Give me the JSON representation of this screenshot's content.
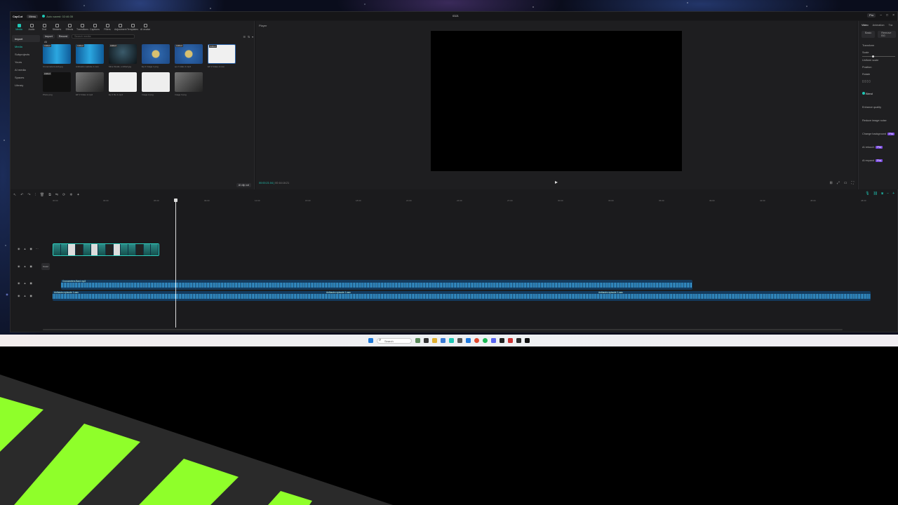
{
  "app": {
    "logo": "CapCut",
    "menu_label": "Menu",
    "autosave": "Auto saved: 02:46:35",
    "project_title": "0321",
    "pro_label": "Pro"
  },
  "toolbar": {
    "tabs": [
      "Media",
      "Audio",
      "Text",
      "Stickers",
      "Effects",
      "Transitions",
      "Captions",
      "Filters",
      "Adjustment",
      "Templates",
      "AI avatar"
    ]
  },
  "sidebar": {
    "items": [
      "Import",
      "Media",
      "Subprojects",
      "Yours",
      "AI media",
      "Spaces",
      "Library"
    ]
  },
  "media": {
    "import_label": "Import",
    "record_label": "Record",
    "search_placeholder": "Search media",
    "filter_all": "All",
    "items": [
      {
        "badge": "Added",
        "caption": "Cronometers.web.jpg"
      },
      {
        "badge": "Added",
        "caption": "Anthastro website 1.mov"
      },
      {
        "badge": "Added",
        "caption": "Mine Studio, untitled.jpg"
      },
      {
        "badge": "",
        "caption": "Ep 2 Image 1.png"
      },
      {
        "badge": "Added",
        "caption": "ep 2 video 1.mp4"
      },
      {
        "badge": "Added",
        "caption": "EP 2 Video 2.mov"
      },
      {
        "badge": "Added",
        "caption": "Photo.png"
      },
      {
        "badge": "",
        "caption": "EP 3 Video 2.mp4"
      },
      {
        "badge": "",
        "caption": "Ep 3 file 4.mp4"
      },
      {
        "badge": "",
        "caption": "Image 2.png"
      },
      {
        "badge": "",
        "caption": "Image 3.png"
      }
    ],
    "ai_clip": "AI clip cut"
  },
  "player": {
    "title": "Player",
    "current_time": "00:00:21:04",
    "total_time": "00:16:16:21"
  },
  "properties": {
    "tabs": [
      "Video",
      "Animation",
      "Tra"
    ],
    "subtabs": [
      "Basic",
      "Remove BG"
    ],
    "rows": [
      "Transform",
      "Scale",
      "Uniform scale",
      "Position",
      "Rotate",
      "Blend",
      "Enhance quality",
      "Reduce image noise",
      "Change background",
      "AI retouch",
      "AI expand"
    ],
    "pill_label": "Pro"
  },
  "timeline": {
    "ticks": [
      "00:00",
      "03:00",
      "06:00",
      "09:00",
      "12:00",
      "15:00",
      "18:00",
      "21:00",
      "24:00",
      "27:00",
      "30:00",
      "33:00",
      "36:00",
      "39:00",
      "42:00",
      "45:00",
      "48:00"
    ],
    "cover_label": "Cover",
    "audio_tracks": [
      {
        "label": "Cronometers Bard.mp3"
      },
      {
        "labels": [
          "Anthastro episode 1.wav",
          "Anthastro episode 1.wav",
          "Anthastro episode 1.wav"
        ]
      }
    ]
  },
  "taskbar": {
    "search_label": "Search"
  },
  "colors": {
    "accent": "#1fc7b5",
    "stripe_green": "#8fff2a",
    "video_track": "#1e6e6a",
    "audio_track": "#143a5c"
  }
}
